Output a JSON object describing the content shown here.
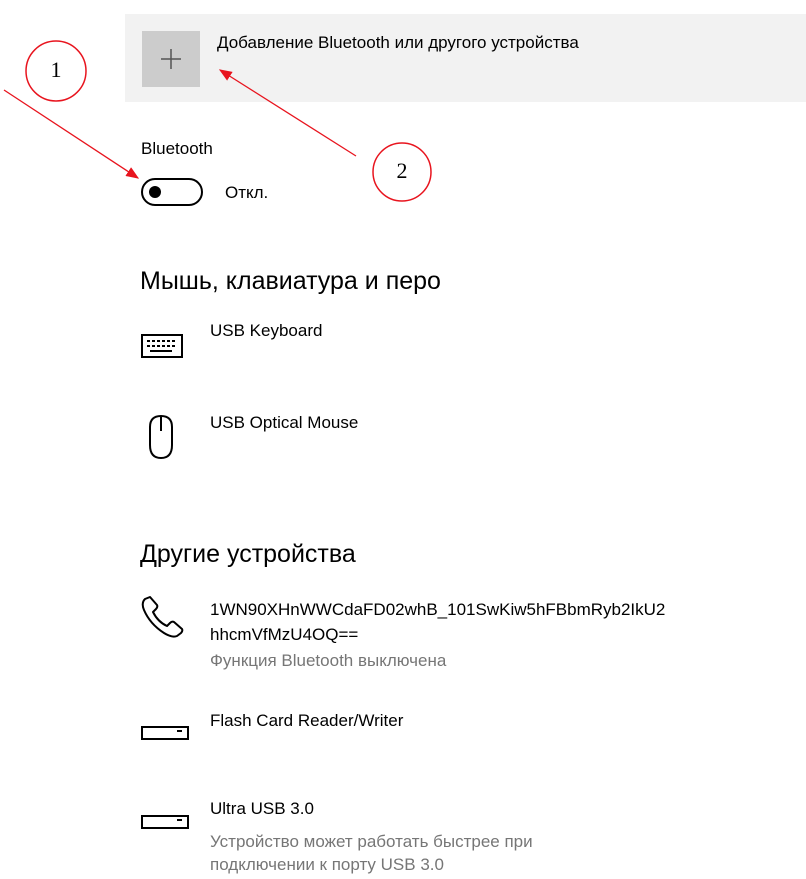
{
  "add_device": {
    "label": "Добавление Bluetooth или другого устройства",
    "icon": "plus-icon"
  },
  "bluetooth": {
    "label": "Bluetooth",
    "toggle_state": "Откл.",
    "toggle_on": false
  },
  "mouse_section": {
    "title": "Мышь, клавиатура и перо",
    "devices": [
      {
        "icon": "keyboard-icon",
        "name": "USB Keyboard"
      },
      {
        "icon": "mouse-icon",
        "name": "USB Optical Mouse"
      }
    ]
  },
  "other_section": {
    "title": "Другие устройства",
    "devices": [
      {
        "icon": "phone-icon",
        "name_line1": "1WN90XHnWWCdaFD02whB_101SwKiw5hFBbmRyb2IkU2",
        "name_line2": "hhcmVfMzU4OQ==",
        "status": "Функция Bluetooth выключена"
      },
      {
        "icon": "card-reader-icon",
        "name": "Flash Card Reader/Writer"
      },
      {
        "icon": "usb-drive-icon",
        "name": "Ultra USB 3.0",
        "status_line1": "Устройство может работать быстрее при",
        "status_line2": "подключении к порту USB 3.0"
      }
    ]
  },
  "annotations": {
    "marker1": "1",
    "marker2": "2",
    "color": "#e8141e"
  }
}
